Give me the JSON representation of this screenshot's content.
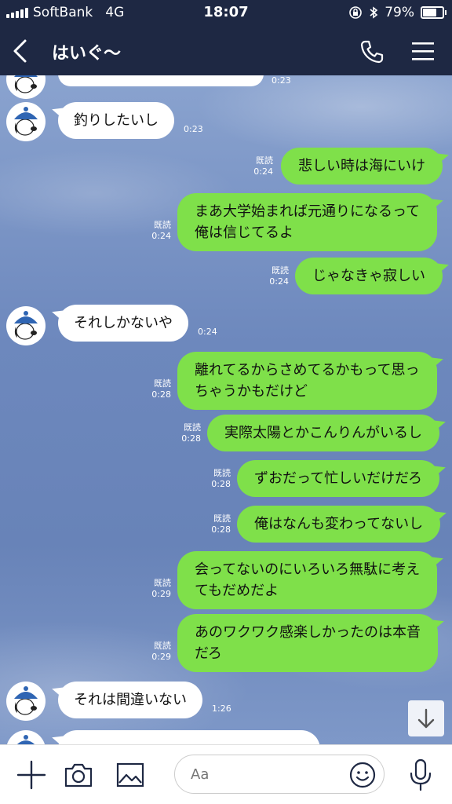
{
  "status_bar": {
    "carrier": "SoftBank",
    "network": "4G",
    "time": "18:07",
    "battery_percent_text": "79%",
    "battery_level": 0.79,
    "icons": [
      "signal-icon",
      "orientation-lock-icon",
      "bluetooth-icon",
      "battery-icon"
    ]
  },
  "header": {
    "title": "はいぐ〜",
    "icons": [
      "back-arrow-icon",
      "phone-icon",
      "hamburger-menu-icon"
    ]
  },
  "messages": [
    {
      "side": "in",
      "text": "",
      "time": "0:23",
      "partial": true
    },
    {
      "side": "in",
      "text": "釣りしたいし",
      "time": "0:23"
    },
    {
      "side": "out",
      "lines": [
        "悲しい時は海にいけ"
      ],
      "read": "既読",
      "time": "0:24"
    },
    {
      "side": "out",
      "lines": [
        "まあ大学始まれば元通りになるって",
        "俺は信じてるよ"
      ],
      "read": "既読",
      "time": "0:24"
    },
    {
      "side": "out",
      "lines": [
        "じゃなきゃ寂しい"
      ],
      "read": "既読",
      "time": "0:24"
    },
    {
      "side": "in",
      "text": "それしかないや",
      "time": "0:24"
    },
    {
      "side": "out",
      "lines": [
        "離れてるからさめてるかもって思っ",
        "ちゃうかもだけど"
      ],
      "read": "既読",
      "time": "0:28"
    },
    {
      "side": "out",
      "lines": [
        "実際太陽とかこんりんがいるし"
      ],
      "read": "既読",
      "time": "0:28"
    },
    {
      "side": "out",
      "lines": [
        "ずおだって忙しいだけだろ"
      ],
      "read": "既読",
      "time": "0:28"
    },
    {
      "side": "out",
      "lines": [
        "俺はなんも変わってないし"
      ],
      "read": "既読",
      "time": "0:28"
    },
    {
      "side": "out",
      "lines": [
        "会ってないのにいろいろ無駄に考え",
        "てもだめだよ"
      ],
      "read": "既読",
      "time": "0:29"
    },
    {
      "side": "out",
      "lines": [
        "あのワクワク感楽しかったのは本音",
        "だろ"
      ],
      "read": "既読",
      "time": "0:29"
    },
    {
      "side": "in",
      "text": "それは間違いない",
      "time": "1:26"
    },
    {
      "side": "in",
      "text": "",
      "partial": true
    }
  ],
  "input_bar": {
    "placeholder": "Aa",
    "icons": [
      "plus-icon",
      "camera-icon",
      "image-icon",
      "emoji-icon",
      "microphone-icon"
    ]
  },
  "colors": {
    "header_bg": "#1e2843",
    "outgoing_bubble": "#7fe04a",
    "incoming_bubble": "#ffffff"
  }
}
